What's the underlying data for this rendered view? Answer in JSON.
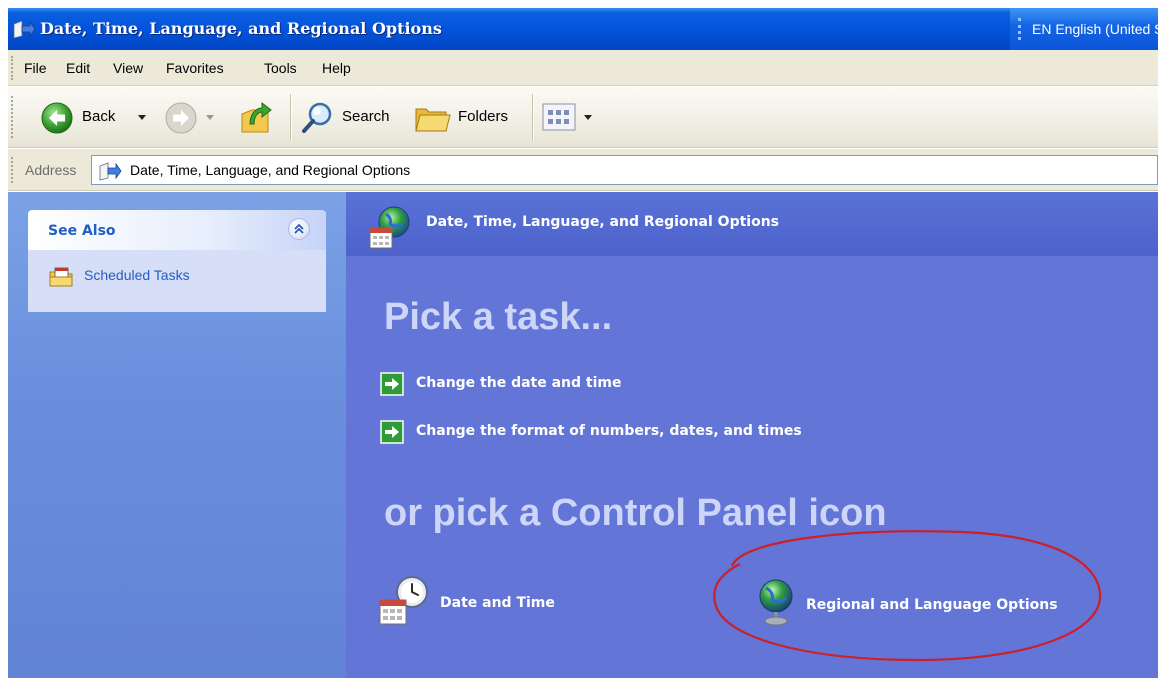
{
  "window": {
    "title": "Date, Time, Language, and Regional Options",
    "language_bar": "EN English (United States)"
  },
  "menu": [
    "File",
    "Edit",
    "View",
    "Favorites",
    "Tools",
    "Help"
  ],
  "toolbar": {
    "back_label": "Back",
    "search_label": "Search",
    "folders_label": "Folders"
  },
  "address": {
    "label": "Address",
    "value": "Date, Time, Language, and Regional Options"
  },
  "see_also": {
    "title": "See Also",
    "items": [
      {
        "label": "Scheduled Tasks",
        "icon": "scheduled-tasks-icon"
      }
    ]
  },
  "main": {
    "header": "Date, Time, Language, and Regional Options",
    "pick_task_heading": "Pick a task...",
    "tasks": [
      {
        "label": "Change the date and time"
      },
      {
        "label": "Change the format of numbers, dates, and times"
      }
    ],
    "pick_icon_heading": "or pick a Control Panel icon",
    "icons": [
      {
        "label": "Date and Time",
        "icon": "date-time-icon"
      },
      {
        "label": "Regional and Language Options",
        "icon": "globe-icon"
      }
    ]
  },
  "colors": {
    "titlebar": "#0352d8",
    "task_pane": "#6a8fdd",
    "content": "#6375d6",
    "heading_text": "#cdd6f8",
    "link_blue": "#215dc6",
    "highlight_ellipse": "#cc1f2a"
  }
}
